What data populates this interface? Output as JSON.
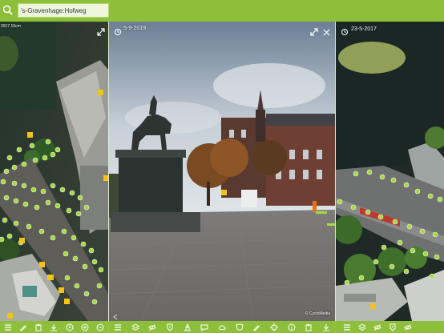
{
  "search": {
    "value": "'s-Gravenhage:Hofweg",
    "placeholder": ""
  },
  "panels": {
    "left": {
      "date": "2017 10cm",
      "expand_icon": "expand-arrows-icon"
    },
    "middle": {
      "date": "5-9-2019",
      "credit": "© CycloMedia",
      "icons": [
        "expand-arrows-icon",
        "close-icon"
      ]
    },
    "right": {
      "date": "23-5-2017",
      "icons": [
        "camera-icon",
        "close-icon"
      ]
    }
  },
  "map_labels": [
    "8",
    "10",
    "11",
    "7",
    "4",
    "10",
    "22",
    "43",
    "4"
  ],
  "toolbars": {
    "left": [
      "menu-icon",
      "pencil-icon",
      "clipboard-icon",
      "download-icon",
      "compass-icon",
      "plus-icon",
      "minus-icon"
    ],
    "middle": [
      "menu-icon",
      "layers-icon",
      "eye-off-icon",
      "info-icon",
      "measure-height-icon",
      "comment-icon",
      "cloud-icon",
      "shield-icon",
      "pencil-icon",
      "crosshair-icon",
      "info-circle-icon",
      "clipboard-icon",
      "download-icon"
    ],
    "right": [
      "menu-icon",
      "layers-icon",
      "eye-off-icon",
      "info-icon",
      "eye-off-icon"
    ]
  },
  "colors": {
    "accent": "#8dbf3a",
    "marker": "#a6d94a",
    "label": "#f2c318"
  }
}
